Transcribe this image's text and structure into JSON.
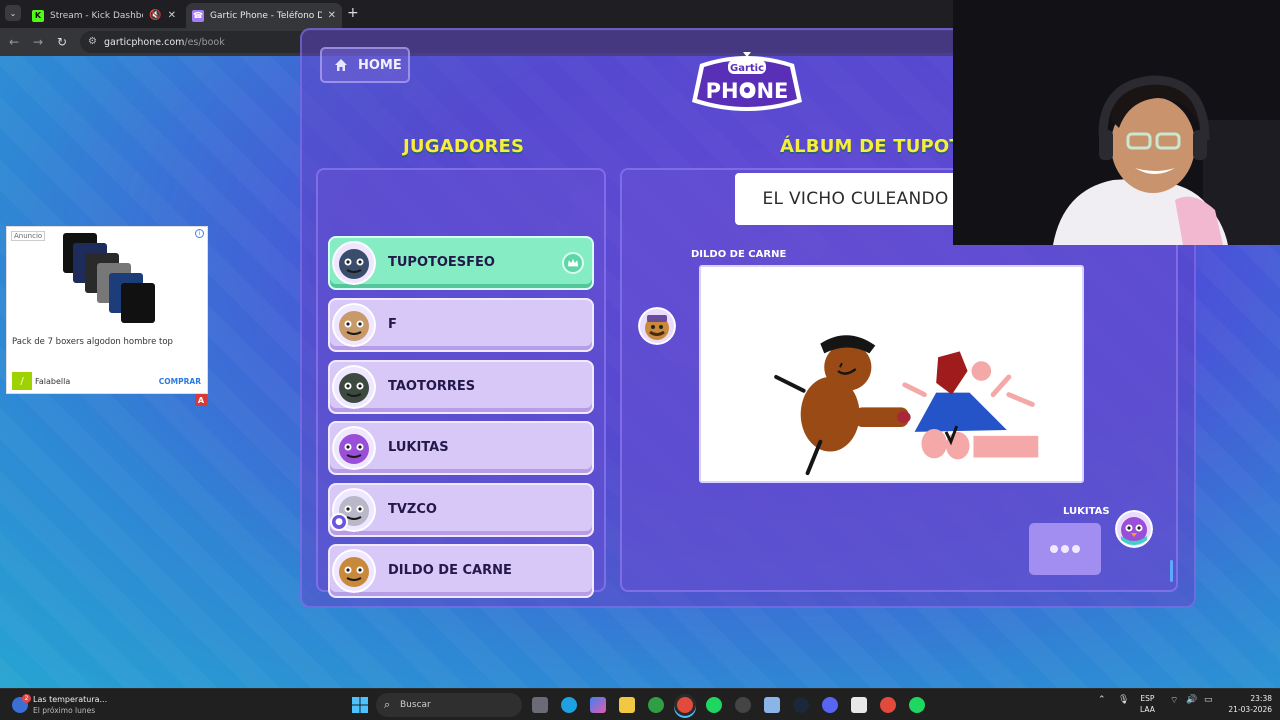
{
  "browser": {
    "tabs": [
      {
        "title": "Stream - Kick Dashboard",
        "favicon": "K",
        "color": "#53fc18",
        "muted": true
      },
      {
        "title": "Gartic Phone - Teléfono Descon",
        "favicon": "☎",
        "color": "#a77cf6",
        "active": true
      }
    ],
    "url_host": "garticphone.com",
    "url_path": "/es/book"
  },
  "page": {
    "home_label": "HOME",
    "players_heading": "JUGADORES",
    "album_heading": "ÁLBUM DE TUPOTO",
    "players": [
      {
        "name": "TUPOTOESFEO",
        "active": true,
        "host": true,
        "avatar": "ghost-avatar",
        "avatar_color": "#3a4d6a"
      },
      {
        "name": "F",
        "avatar": "cat-avatar",
        "avatar_color": "#c89a6a"
      },
      {
        "name": "TAOTORRES",
        "avatar": "bomb-avatar",
        "avatar_color": "#3d4a40"
      },
      {
        "name": "LUKITAS",
        "avatar": "bird-avatar",
        "avatar_color": "#9a4fd8"
      },
      {
        "name": "TVZCO",
        "avatar": "knight-avatar",
        "avatar_color": "#b8b8c8",
        "badge": true
      },
      {
        "name": "DILDO DE CARNE",
        "avatar": "mustache-avatar",
        "avatar_color": "#c88a3a"
      }
    ],
    "caption": "EL VICHO CULEANDO UNA MUÑECA",
    "drawing_author": "DILDO DE CARNE",
    "typing_author": "LUKITAS",
    "typing_text": "•••"
  },
  "ad": {
    "label": "Anuncio",
    "product": "Pack de 7 boxers algodon hombre top",
    "brand": "Falabella",
    "cta": "COMPRAR"
  },
  "taskbar": {
    "weather_line1": "Las temperatura...",
    "weather_line2": "El próximo lunes",
    "weather_badge": "2",
    "search_placeholder": "Buscar",
    "lang_line1": "ESP",
    "lang_line2": "LAA",
    "time": "23:38",
    "date": "21-03-2026"
  },
  "colors": {
    "heading": "#f8ec3c",
    "active_player": "#86ecc4",
    "player": "#d8c8f8"
  }
}
